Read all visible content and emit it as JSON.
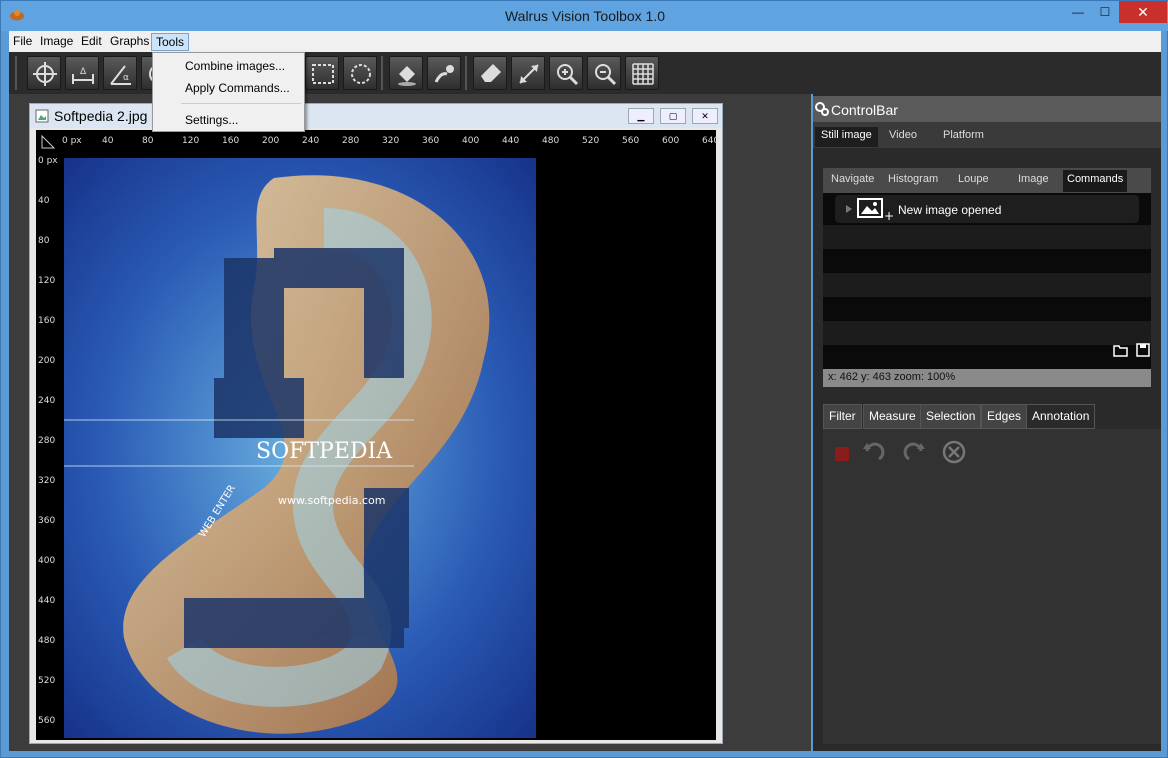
{
  "window": {
    "title": "Walrus Vision Toolbox 1.0",
    "min_label": "—",
    "max_label": "☐",
    "close_label": "✕"
  },
  "menubar": {
    "items": [
      "File",
      "Image",
      "Edit",
      "Graphs",
      "Tools"
    ],
    "active": "Tools"
  },
  "tools_menu": {
    "items": [
      "Combine images...",
      "Apply Commands...",
      "Settings..."
    ]
  },
  "document": {
    "title": "Softpedia 2.jpg",
    "ruler_top": [
      "0 px",
      "40",
      "80",
      "120",
      "160",
      "200",
      "240",
      "280",
      "320",
      "360",
      "400",
      "440",
      "480",
      "520",
      "560",
      "600",
      "640"
    ],
    "ruler_left": [
      "0 px",
      "40",
      "80",
      "120",
      "160",
      "200",
      "240",
      "280",
      "320",
      "360",
      "400",
      "440",
      "480",
      "520",
      "560"
    ],
    "image_text": "SOFTPEDIA",
    "image_url_text": "www.softpedia.com",
    "image_web_text": "WEB ENTER"
  },
  "controlbar": {
    "title": "ControlBar",
    "tabs": [
      "Still image",
      "Video",
      "Platform"
    ],
    "selected_tab": "Still image",
    "inner_tabs": [
      "Navigate",
      "Histogram",
      "Loupe",
      "Image",
      "Commands"
    ],
    "selected_inner_tab": "Commands",
    "commands": [
      "New image opened"
    ],
    "status": "x: 462 y: 463 zoom: 100%",
    "bottom_tabs": [
      "Filter",
      "Measure",
      "Selection",
      "Edges",
      "Annotation"
    ],
    "selected_bottom_tab": "Annotation"
  },
  "colors": {
    "titlebar": "#5fa3e0",
    "close": "#c9302c",
    "toolbar": "#2b2b2b",
    "panel": "#2a2a2a"
  }
}
